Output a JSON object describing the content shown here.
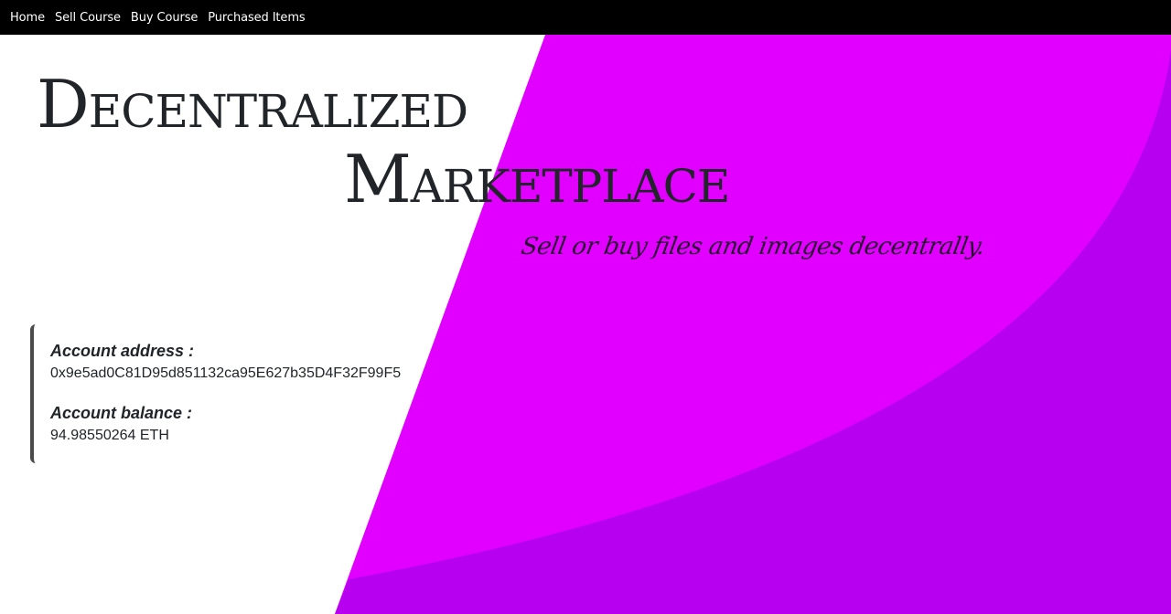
{
  "navbar": {
    "items": [
      {
        "label": "Home"
      },
      {
        "label": "Sell Course"
      },
      {
        "label": "Buy Course"
      },
      {
        "label": "Purchased Items"
      }
    ]
  },
  "hero": {
    "title_line1": "Decentralized",
    "title_line2": "Marketplace",
    "tagline": "Sell or buy files and images decentrally."
  },
  "account": {
    "address_label": "Account address :",
    "address_value": "0x9e5ad0C81D95d851132ca95E627b35D4F32F99F5",
    "balance_label": "Account balance :",
    "balance_value": "94.98550264 ETH"
  },
  "colors": {
    "navbar_bg": "#000000",
    "magenta": "#e100ff",
    "purple": "#b800f0",
    "text": "#212529"
  }
}
